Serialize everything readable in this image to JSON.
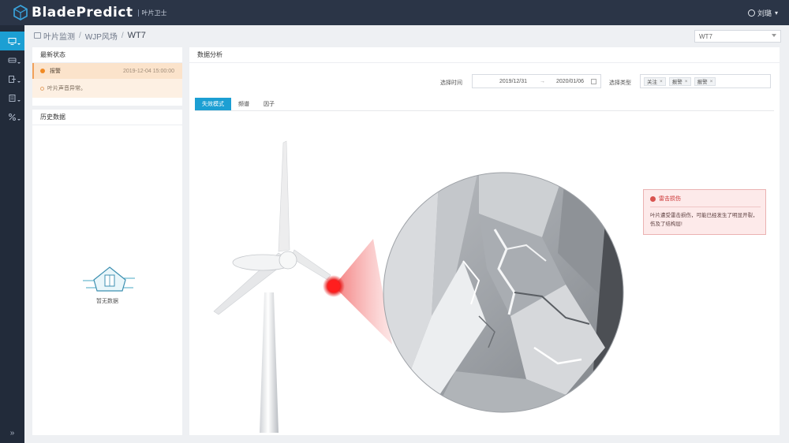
{
  "app": {
    "logo_text": "BladePredict",
    "logo_sub": "叶片卫士",
    "user_name": "刘璐"
  },
  "sidebar": {
    "items": [
      {
        "icon": "monitor-icon",
        "active": true
      },
      {
        "icon": "car-icon",
        "active": false
      },
      {
        "icon": "export-icon",
        "active": false
      },
      {
        "icon": "report-icon",
        "active": false
      },
      {
        "icon": "percent-icon",
        "active": false
      }
    ],
    "collapse_label": "»"
  },
  "breadcrumb": {
    "items": [
      "叶片监测",
      "WJP风场",
      "WT7"
    ]
  },
  "turbine_select": {
    "value": "WT7"
  },
  "latest_status": {
    "title": "最新状态",
    "level": "报警",
    "timestamp": "2019-12-04 15:00:00",
    "note": "叶片声音异常。"
  },
  "history": {
    "title": "历史数据",
    "empty_text": "暂无数据"
  },
  "analysis": {
    "title": "数据分析",
    "time_label": "选择时间",
    "date_start": "2019/12/31",
    "date_sep": "→",
    "date_end": "2020/01/06",
    "type_label": "选择类型",
    "type_tags": [
      "关注",
      "报警",
      "报警"
    ],
    "tabs": [
      "失效模式",
      "频谱",
      "因子"
    ],
    "alert": {
      "title": "雷击损伤",
      "body": "叶片遭受雷击损伤，可能已经发生了明显开裂，伤及了结构层!"
    }
  },
  "colors": {
    "topbar": "#2b3547",
    "sidebar": "#222b3a",
    "accent": "#1c9fd3",
    "warning_bg": "#fbe3cb",
    "alert_red": "#e02020"
  }
}
